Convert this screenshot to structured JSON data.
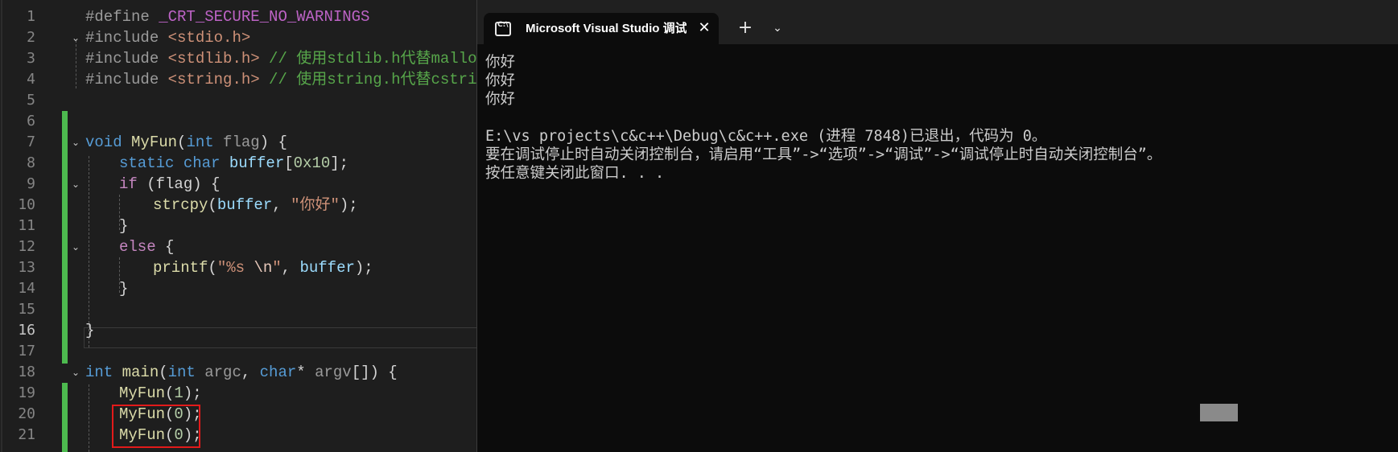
{
  "editor": {
    "active_line": "16",
    "line_numbers": [
      "1",
      "2",
      "3",
      "4",
      "5",
      "6",
      "7",
      "8",
      "9",
      "10",
      "11",
      "12",
      "13",
      "14",
      "15",
      "16",
      "17",
      "18",
      "19",
      "20",
      "21"
    ],
    "code": {
      "l1_pp": "#define ",
      "l1_macro": "_CRT_SECURE_NO_WARNINGS",
      "l2_pp": "#include ",
      "l2_hdr": "<stdio.h>",
      "l3_pp": "#include ",
      "l3_hdr": "<stdlib.h>",
      "l3_cmt": " // 使用stdlib.h代替malloc.h",
      "l4_pp": "#include ",
      "l4_hdr": "<string.h>",
      "l4_cmt": " // 使用string.h代替cstring",
      "l7_kw": "void ",
      "l7_fn": "MyFun",
      "l7_p1": "(",
      "l7_kw2": "int ",
      "l7_prm": "flag",
      "l7_p2": ") {",
      "l8_kw": "static char ",
      "l8_var": "buffer",
      "l8_p1": "[",
      "l8_num": "0x10",
      "l8_p2": "];",
      "l9_ctl": "if ",
      "l9_rest": "(flag) {",
      "l10_fn": "strcpy",
      "l10_p1": "(",
      "l10_var": "buffer",
      "l10_p2": ", ",
      "l10_str": "\"你好\"",
      "l10_p3": ");",
      "l11": "}",
      "l12_ctl": "else ",
      "l12_rest": "{",
      "l13_fn": "printf",
      "l13_p1": "(",
      "l13_str1": "\"%s ",
      "l13_esc": "\\n",
      "l13_str2": "\"",
      "l13_p2": ", ",
      "l13_var": "buffer",
      "l13_p3": ");",
      "l14": "}",
      "l16": "}",
      "l18_kw": "int ",
      "l18_fn": "main",
      "l18_p1": "(",
      "l18_kw2": "int ",
      "l18_prm1": "argc",
      "l18_p2": ", ",
      "l18_kw3": "char",
      "l18_p3": "* ",
      "l18_prm2": "argv",
      "l18_p4": "[]) {",
      "l19_fn": "MyFun",
      "l19_p1": "(",
      "l19_num": "1",
      "l19_p2": ");",
      "l20_fn": "MyFun",
      "l20_p1": "(",
      "l20_num": "0",
      "l20_p2": ");",
      "l21_fn": "MyFun",
      "l21_p1": "(",
      "l21_num": "0",
      "l21_p2": ");"
    }
  },
  "console": {
    "tab_title": "Microsoft Visual Studio 调试控制台",
    "tab_icon_text": "C:\\",
    "close_glyph": "✕",
    "new_tab_glyph": "+",
    "menu_glyph": "⌄",
    "output": [
      "你好",
      "你好",
      "你好",
      "",
      "E:\\vs projects\\c&c++\\Debug\\c&c++.exe (进程 7848)已退出，代码为 0。",
      "要在调试停止时自动关闭控制台，请启用“工具”->“选项”->“调试”->“调试停止时自动关闭控制台”。",
      "按任意键关闭此窗口. . ."
    ]
  },
  "colors": {
    "editor_bg": "#1e1e1e",
    "console_bg": "#0c0c0c",
    "change_bar": "#4dba4f",
    "highlight_box": "#e21a1a"
  },
  "icons": {
    "fold": "chevron-down-icon",
    "tab": "terminal-icon",
    "close": "close-icon",
    "new_tab": "plus-icon",
    "menu": "chevron-down-icon"
  }
}
